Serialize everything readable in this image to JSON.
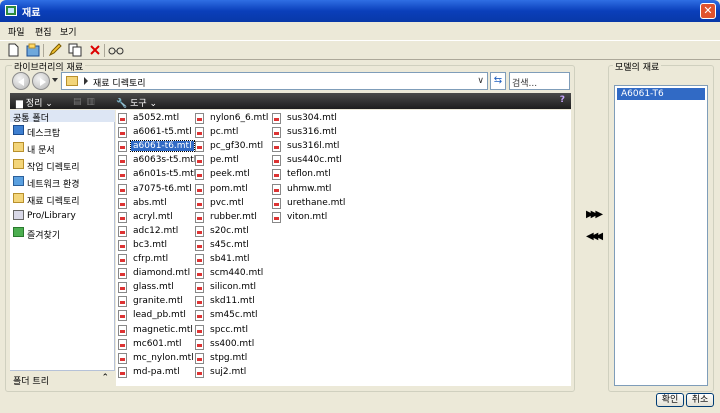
{
  "window": {
    "title": "재료",
    "close_glyph": "✕"
  },
  "menu": [
    "파일",
    "편집",
    "보기"
  ],
  "toolbar_icons": [
    "new-icon",
    "open-icon",
    "edit-icon",
    "copy-icon",
    "delete-icon",
    "glasses-icon"
  ],
  "library": {
    "group_title": "라이브러리의 재료",
    "address_path": "재료 디렉토리",
    "search_placeholder": "검색...",
    "organize_label": "정리",
    "tools_label": "도구",
    "side_header": "공통 폴더",
    "side_items": [
      "데스크탑",
      "내 문서",
      "작업 디렉토리",
      "네트워크 환경",
      "재료 디렉토리",
      "Pro/Library",
      "즐겨찾기"
    ],
    "side_footer": "폴더 트리",
    "files_col1": [
      "a5052.mtl",
      "a6061-t5.mtl",
      "a6061-t6.mtl",
      "a6063s-t5.mtl",
      "a6n01s-t5.mtl",
      "a7075-t6.mtl",
      "abs.mtl",
      "acryl.mtl",
      "adc12.mtl",
      "bc3.mtl",
      "cfrp.mtl",
      "diamond.mtl",
      "glass.mtl",
      "granite.mtl",
      "lead_pb.mtl",
      "magnetic.mtl",
      "mc601.mtl",
      "mc_nylon.mtl",
      "md-pa.mtl"
    ],
    "files_col2": [
      "nylon6_6.mtl",
      "pc.mtl",
      "pc_gf30.mtl",
      "pe.mtl",
      "peek.mtl",
      "pom.mtl",
      "pvc.mtl",
      "rubber.mtl",
      "s20c.mtl",
      "s45c.mtl",
      "sb41.mtl",
      "scm440.mtl",
      "silicon.mtl",
      "skd11.mtl",
      "sm45c.mtl",
      "spcc.mtl",
      "ss400.mtl",
      "stpg.mtl",
      "suj2.mtl"
    ],
    "files_col3": [
      "sus304.mtl",
      "sus316.mtl",
      "sus316l.mtl",
      "sus440c.mtl",
      "teflon.mtl",
      "uhmw.mtl",
      "urethane.mtl",
      "viton.mtl"
    ],
    "selected_file": "a6061-t6.mtl"
  },
  "model": {
    "group_title": "모델의 재료",
    "items": [
      "A6061-T6"
    ]
  },
  "buttons": {
    "add": "▶▶▶",
    "remove": "◀◀◀",
    "ok": "확인",
    "cancel": "취소"
  },
  "colors": {
    "selection": "#316ac5",
    "titlebar": "#0a3fba"
  }
}
